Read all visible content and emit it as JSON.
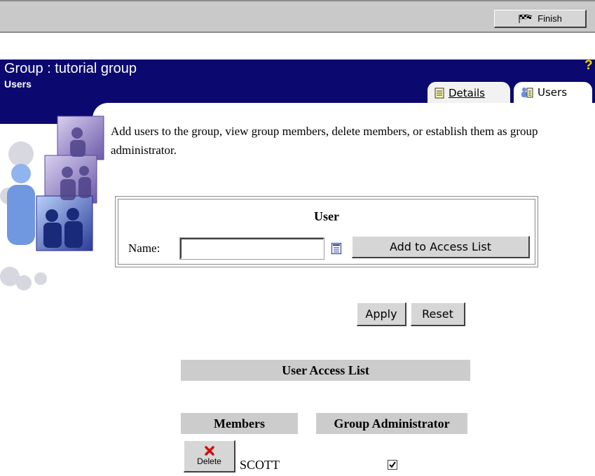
{
  "toolbar": {
    "finish_label": "Finish"
  },
  "header": {
    "title": "Group : tutorial group",
    "subtitle": "Users",
    "help_glyph": "?"
  },
  "tabs": [
    {
      "label": "Details",
      "icon": "document-icon",
      "active": false
    },
    {
      "label": "Users",
      "icon": "users-icon",
      "active": true
    }
  ],
  "intro_text": "Add users to the group, view group members, delete members, or establish them as group administrator.",
  "user_box": {
    "heading": "User",
    "name_label": "Name:",
    "name_value": "",
    "add_button": "Add to Access List"
  },
  "actions": {
    "apply": "Apply",
    "reset": "Reset"
  },
  "access_list": {
    "title": "User Access List",
    "columns": [
      "Members",
      "Group Administrator"
    ],
    "rows": [
      {
        "delete_label": "Delete",
        "member": "SCOTT",
        "is_admin": true
      }
    ]
  },
  "colors": {
    "header_navy": "#0b0870",
    "toolbar_gray": "#c9c9c9",
    "table_header_gray": "#cccccc",
    "help_yellow": "#ffd600",
    "delete_red": "#cc1111"
  }
}
